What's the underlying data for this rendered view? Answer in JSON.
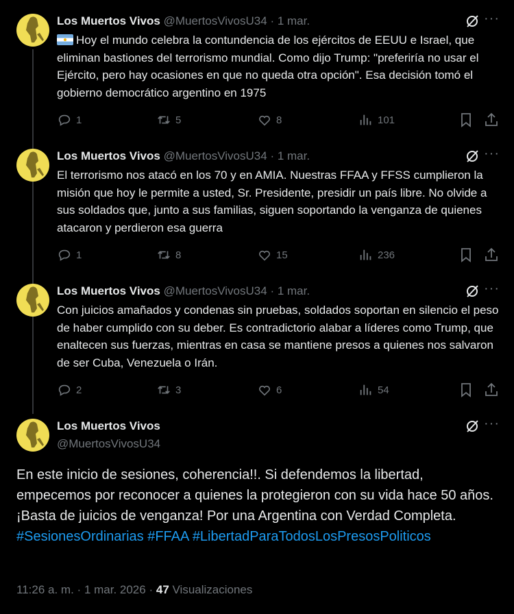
{
  "author": {
    "name": "Los Muertos Vivos",
    "handle": "@MuertosVivosU34"
  },
  "separator": "·",
  "tweets": [
    {
      "date": "1 mar.",
      "text": "Hoy el mundo celebra la contundencia de los ejércitos de EEUU e Israel, que eliminan bastiones del terrorismo mundial. Como dijo Trump: \"preferiría no usar el Ejército, pero hay ocasiones en que no queda otra opción\". Esa decisión tomó el gobierno democrático argentino en 1975",
      "replies": "1",
      "reposts": "5",
      "likes": "8",
      "views": "101"
    },
    {
      "date": "1 mar.",
      "text": "El terrorismo nos atacó en los 70 y en AMIA. Nuestras FFAA y FFSS cumplieron la misión que hoy le permite a usted, Sr. Presidente, presidir un país libre. No olvide a sus soldados que, junto a sus familias, siguen soportando la venganza de quienes atacaron y perdieron esa guerra",
      "replies": "1",
      "reposts": "8",
      "likes": "15",
      "views": "236"
    },
    {
      "date": "1 mar.",
      "text": "Con juicios amañados y condenas sin pruebas,  soldados soportan en silencio el peso de haber cumplido con su deber. Es contradictorio alabar a líderes como Trump, que enaltecen sus fuerzas, mientras en casa se mantiene presos a quienes nos salvaron de ser Cuba, Venezuela o Irán.",
      "replies": "2",
      "reposts": "3",
      "likes": "6",
      "views": "54"
    }
  ],
  "main_tweet": {
    "text": "En este inicio de sesiones, coherencia!!. Si defendemos la libertad, empecemos por reconocer a quienes la protegieron con su vida hace 50 años. ¡Basta de juicios de venganza! Por una Argentina con Verdad Completa.",
    "hashtags": [
      "#SesionesOrdinarias",
      "#FFAA",
      "#LibertadParaTodosLosPresosPoliticos"
    ],
    "time": "11:26 a. m.",
    "date": "1 mar. 2026",
    "views_count": "47",
    "views_label": "Visualizaciones"
  },
  "colors": {
    "background": "#000000",
    "text": "#e7e9ea",
    "muted": "#71767b",
    "link": "#1d9bf0",
    "avatar": "#f0dd55"
  },
  "icons": [
    "flag-argentina-icon",
    "grok-icon",
    "more-icon",
    "reply-icon",
    "repost-icon",
    "like-icon",
    "views-icon",
    "bookmark-icon",
    "share-icon"
  ]
}
